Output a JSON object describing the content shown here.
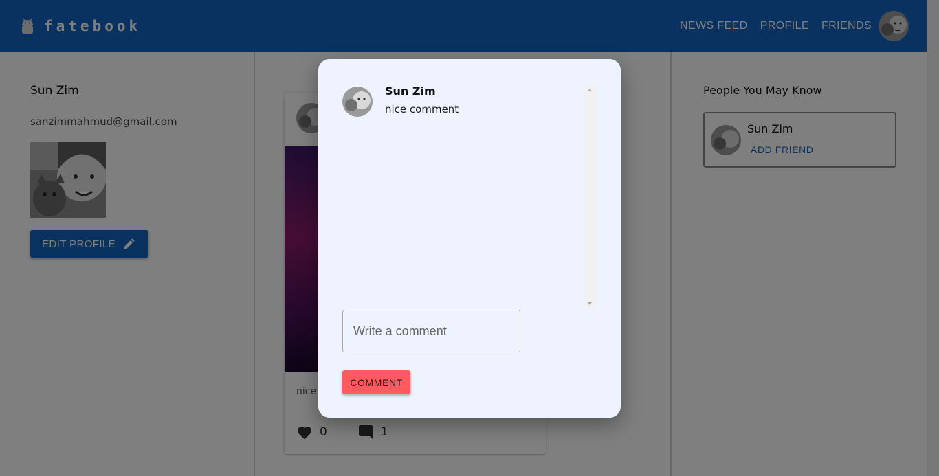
{
  "app": {
    "brand": "fatebook",
    "nav": [
      "NEWS FEED",
      "PROFILE",
      "FRIENDS"
    ]
  },
  "profile": {
    "name": "Sun Zim",
    "email": "sanzimmahmud@gmail.com",
    "edit_label": "EDIT PROFILE"
  },
  "post": {
    "caption": "nice",
    "likes": "0",
    "comments": "1"
  },
  "people": {
    "title": "People You May Know",
    "items": [
      {
        "name": "Sun Zim",
        "action": "ADD FRIEND"
      }
    ]
  },
  "dialog": {
    "comments": [
      {
        "author": "Sun Zim",
        "text": "nice comment"
      }
    ],
    "input_placeholder": "Write a comment",
    "submit_label": "COMMENT"
  },
  "colors": {
    "primary": "#1565c0",
    "accent": "#ff5a5f",
    "dialog_bg": "#eef3ff"
  },
  "icons": [
    "android-icon",
    "edit-pencil-icon",
    "heart-icon",
    "comment-icon"
  ]
}
